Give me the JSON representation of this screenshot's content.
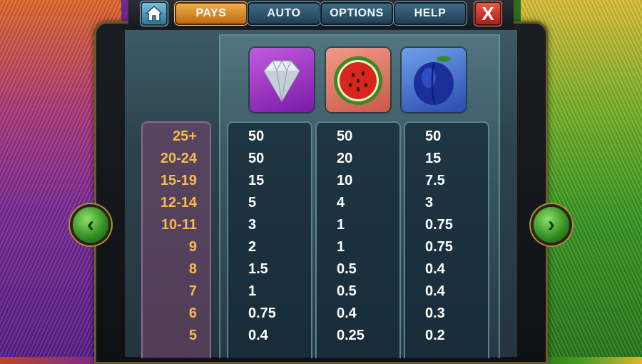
{
  "nav": {
    "tabs": [
      {
        "label": "PAYS",
        "active": true
      },
      {
        "label": "AUTO",
        "active": false
      },
      {
        "label": "OPTIONS",
        "active": false
      },
      {
        "label": "HELP",
        "active": false
      }
    ],
    "close_label": "X"
  },
  "paytable": {
    "symbols": [
      "diamond",
      "watermelon",
      "plum"
    ],
    "counts": [
      "25+",
      "20-24",
      "15-19",
      "12-14",
      "10-11",
      "9",
      "8",
      "7",
      "6",
      "5"
    ],
    "payouts": {
      "diamond": [
        "50",
        "50",
        "15",
        "5",
        "3",
        "2",
        "1.5",
        "1",
        "0.75",
        "0.4"
      ],
      "watermelon": [
        "50",
        "20",
        "10",
        "4",
        "1",
        "1",
        "0.5",
        "0.5",
        "0.4",
        "0.25"
      ],
      "plum": [
        "50",
        "15",
        "7.5",
        "3",
        "0.75",
        "0.75",
        "0.4",
        "0.4",
        "0.3",
        "0.2"
      ]
    }
  },
  "arrows": {
    "prev": "‹",
    "next": "›"
  },
  "colors": {
    "accent_orange": "#f6bb4a",
    "tab_active": "#e08f2a",
    "close_red": "#c82a1e"
  }
}
